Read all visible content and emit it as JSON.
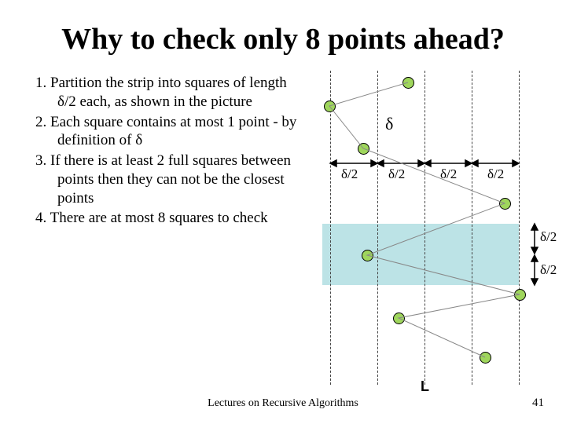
{
  "title": "Why to check only 8 points ahead?",
  "items": [
    {
      "num": "1.",
      "prefix": "Partition the strip into squares of length ",
      "sym": "δ",
      "mid": "/2 each, as shown in the picture"
    },
    {
      "num": "2.",
      "prefix": "Each square contains at most ",
      "hl": "1",
      "mid": " point - by definition of ",
      "sym": "δ"
    },
    {
      "num": "3.",
      "prefix": "If there is at least ",
      "hl": "2",
      "mid": " full squares between points then they can not be the closest points"
    },
    {
      "num": "4.",
      "prefix": "There are at most ",
      "hl": "8",
      "mid": " squares to check"
    }
  ],
  "labels": {
    "delta": "δ",
    "d2": "δ/2",
    "L": "L"
  },
  "colors": {
    "point": "#9fd65c",
    "band": "#bce3e6"
  },
  "footer": "Lectures on Recursive Algorithms",
  "page": "41"
}
